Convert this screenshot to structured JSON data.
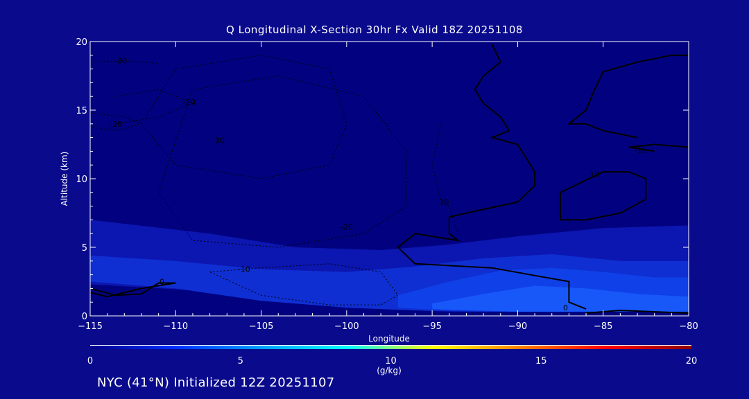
{
  "chart_data": {
    "type": "contour",
    "title": "Q Longitudinal X-Section 30hr  Fx Valid 18Z 20251108",
    "xlabel": "Longitude",
    "ylabel": "Altitude (km)",
    "xlim": [
      -115,
      -80
    ],
    "ylim": [
      0,
      20
    ],
    "x_ticks": [
      -115,
      -110,
      -105,
      -100,
      -95,
      -90,
      -85,
      -80
    ],
    "x_tick_labels": [
      "−115",
      "−110",
      "−105",
      "−100",
      "−95",
      "−90",
      "−85",
      "−80"
    ],
    "y_ticks": [
      0,
      5,
      10,
      15,
      20
    ],
    "y_tick_labels": [
      "0",
      "5",
      "10",
      "15",
      "20"
    ],
    "filled_field": {
      "quantity": "Q",
      "units": "(g/kg)",
      "colorbar_range": [
        0,
        20
      ],
      "colorbar_ticks": [
        "0",
        "5",
        "10",
        "15",
        "20"
      ],
      "regions": [
        {
          "q": 1.0,
          "lon": [
            -115,
            -108,
            -103,
            -98,
            -94,
            -90,
            -85,
            -80,
            -80,
            -85,
            -90,
            -94,
            -98,
            -103,
            -108,
            -115
          ],
          "alt": [
            7.0,
            6.0,
            5.0,
            4.8,
            5.2,
            5.8,
            6.4,
            6.6,
            0.3,
            0.3,
            0.3,
            0.3,
            0.5,
            1.0,
            1.8,
            2.3
          ]
        },
        {
          "q": 2.0,
          "lon": [
            -115,
            -110,
            -105,
            -100,
            -96,
            -92,
            -88,
            -84,
            -80,
            -80,
            -84,
            -88,
            -92,
            -96,
            -100,
            -105,
            -110,
            -115
          ],
          "alt": [
            4.4,
            4.0,
            3.4,
            3.2,
            3.6,
            4.2,
            4.5,
            4.0,
            4.0,
            0.3,
            0.3,
            0.3,
            0.3,
            0.4,
            0.6,
            1.1,
            2.0,
            2.5
          ]
        },
        {
          "q": 3.0,
          "lon": [
            -97,
            -94,
            -91,
            -88,
            -85,
            -82,
            -80,
            -80,
            -85,
            -90,
            -94,
            -97
          ],
          "alt": [
            1.5,
            2.5,
            3.3,
            3.5,
            3.2,
            2.8,
            2.8,
            0.3,
            0.3,
            0.3,
            0.4,
            0.6
          ]
        },
        {
          "q": 4.0,
          "lon": [
            -95,
            -92,
            -89,
            -86,
            -83,
            -80,
            -80,
            -85,
            -90,
            -95
          ],
          "alt": [
            0.9,
            1.6,
            2.2,
            2.0,
            1.6,
            1.4,
            0.3,
            0.3,
            0.3,
            0.5
          ]
        }
      ]
    },
    "contours": [
      {
        "level": 0,
        "style": "solid",
        "lon": [
          -91.5,
          -91,
          -92,
          -92.5,
          -92,
          -91,
          -90.5,
          -91.5,
          -90,
          -89.5,
          -89,
          -89,
          -90,
          -93,
          -94,
          -94,
          -93.5,
          -96,
          -97,
          -96,
          -91.5,
          -87,
          -87,
          -86
        ],
        "alt": [
          19.8,
          18.5,
          17.5,
          16.5,
          15.5,
          14.5,
          13.5,
          13.0,
          12.5,
          11.5,
          10.5,
          9.5,
          8.3,
          7.5,
          7.2,
          6.0,
          5.5,
          6.0,
          5.0,
          3.8,
          3.5,
          2.5,
          1.0,
          0.5
        ],
        "label": "0",
        "label_at": [
          -87.2,
          0.6
        ]
      },
      {
        "level": 0,
        "style": "solid",
        "lon": [
          -115,
          -113.5,
          -112,
          -111,
          -110,
          -112,
          -114,
          -115
        ],
        "alt": [
          2.0,
          1.5,
          1.6,
          2.4,
          2.4,
          2.0,
          1.4,
          1.7
        ],
        "label": "0",
        "label_at": [
          -110.8,
          2.5
        ]
      },
      {
        "level": 0,
        "style": "solid",
        "lon": [
          -80,
          -81,
          -83,
          -85,
          -85.5,
          -86,
          -87,
          -86,
          -85,
          -83
        ],
        "alt": [
          19.0,
          19.0,
          18.5,
          17.8,
          16.5,
          15.0,
          14.0,
          14.0,
          13.5,
          13.0
        ],
        "label": "",
        "label_at": null
      },
      {
        "level": 0,
        "style": "solid",
        "lon": [
          -86,
          -84,
          -80
        ],
        "alt": [
          0.2,
          0.4,
          0.2
        ],
        "label": "",
        "label_at": null
      },
      {
        "level": 10,
        "style": "solid",
        "lon": [
          -87.5,
          -87.5,
          -85,
          -83.5,
          -82.5,
          -82.5,
          -84,
          -86,
          -87.5
        ],
        "alt": [
          7.0,
          9.0,
          10.5,
          10.5,
          10.0,
          8.5,
          7.5,
          7.0,
          7.0
        ],
        "label": "10",
        "label_at": [
          -85.5,
          10.3
        ]
      },
      {
        "level": 10,
        "style": "solid",
        "lon": [
          -80,
          -82,
          -83.5,
          -82
        ],
        "alt": [
          12.3,
          12.5,
          12.3,
          12.0
        ],
        "label": "-10",
        "label_at": [
          -82.8,
          12.1
        ]
      },
      {
        "level": -10,
        "style": "dashed",
        "lon": [
          -108,
          -105,
          -101,
          -98,
          -97,
          -98,
          -101,
          -105,
          -108
        ],
        "alt": [
          3.2,
          3.5,
          3.8,
          3.2,
          1.5,
          0.8,
          0.8,
          1.5,
          3.2
        ],
        "label": "-10",
        "label_at": [
          -106.0,
          3.4
        ]
      },
      {
        "level": -20,
        "style": "dashed",
        "lon": [
          -109,
          -104,
          -99,
          -96.5,
          -96.5,
          -99,
          -104,
          -109,
          -111,
          -109
        ],
        "alt": [
          16.5,
          17.5,
          16.0,
          12.0,
          8.0,
          6.0,
          5.0,
          5.5,
          9.0,
          16.5
        ],
        "label": "-20",
        "label_at": [
          -100.0,
          6.5
        ]
      },
      {
        "level": -20,
        "style": "dashed",
        "lon": [
          -113.5,
          -111,
          -109,
          -111,
          -113.5
        ],
        "alt": [
          16.0,
          16.5,
          15.5,
          14.5,
          14.0
        ],
        "label": "-20",
        "label_at": [
          -109.2,
          15.6
        ]
      },
      {
        "level": -20,
        "style": "dashed",
        "lon": [
          -115,
          -113,
          -112,
          -113.5,
          -115
        ],
        "alt": [
          14.8,
          14.5,
          14.0,
          13.5,
          13.8
        ],
        "label": "-20",
        "label_at": [
          -113.5,
          14.0
        ]
      },
      {
        "level": -30,
        "style": "dashed",
        "lon": [
          -110,
          -105,
          -101,
          -100,
          -101,
          -105,
          -110,
          -112,
          -110
        ],
        "alt": [
          18.0,
          19.0,
          18.0,
          14.0,
          11.0,
          10.0,
          11.0,
          14.0,
          18.0
        ],
        "label": "-30",
        "label_at": [
          -107.5,
          12.8
        ]
      },
      {
        "level": -30,
        "style": "dashed",
        "lon": [
          -115,
          -113,
          -111
        ],
        "alt": [
          18.5,
          18.6,
          18.4
        ],
        "label": "-30",
        "label_at": [
          -113.2,
          18.6
        ]
      },
      {
        "level": 10,
        "style": "dashed",
        "lon": [
          -94.5,
          -95,
          -94.5,
          -94,
          -93.5
        ],
        "alt": [
          14.0,
          11.0,
          8.5,
          8.0,
          6.0
        ],
        "label": "10",
        "label_at": [
          -94.3,
          8.3
        ]
      }
    ]
  },
  "footer": "NYC (41°N) Initialized 12Z 20251107",
  "colors": {
    "background": "#0a0a8c",
    "plot_bg": "#020280",
    "fill_levels": [
      "#0c16b0",
      "#0f2fd2",
      "#1040e8",
      "#1858f8"
    ],
    "colorbar": [
      "#00008c",
      "#0030ff",
      "#00a0ff",
      "#00ffff",
      "#ffff00",
      "#ff8000",
      "#ff0000",
      "#8c0000"
    ],
    "contour": "#000000",
    "axis": "#ffffff"
  }
}
